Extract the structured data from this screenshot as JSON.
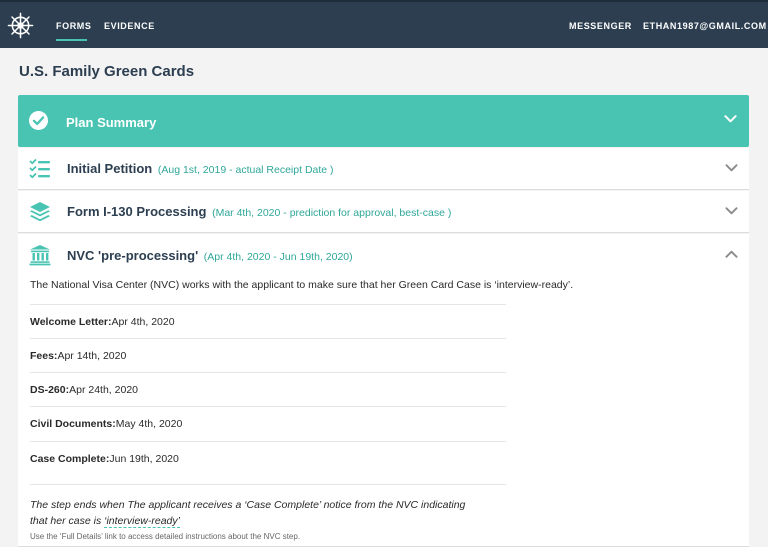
{
  "nav": {
    "logo_icon": "ships-wheel-icon",
    "links": [
      "FORMS",
      "EVIDENCE"
    ],
    "right_links": [
      "MESSENGER",
      "ETHAN1987@GMAIL.COM"
    ],
    "active": "FORMS"
  },
  "page": {
    "title": "U.S. Family Green Cards"
  },
  "summary": {
    "title": "Plan Summary",
    "icon": "check-circle-icon",
    "chevron": "chevron-down-icon"
  },
  "rows": [
    {
      "title": "Initial Petition",
      "subtitle": "(Aug 1st, 2019 - actual Receipt Date )",
      "icon": "checklist-icon",
      "chevron": "chevron-down-icon"
    },
    {
      "title": "Form I-130 Processing",
      "subtitle": "(Mar 4th, 2020 - prediction for approval, best-case )",
      "icon": "layers-icon",
      "chevron": "chevron-down-icon"
    },
    {
      "title": "NVC 'pre-processing'",
      "subtitle": "(Apr 4th, 2020 - Jun 19th, 2020)",
      "icon": "bank-building-icon",
      "chevron": "chevron-up-icon"
    }
  ],
  "nvc": {
    "intro": "The National Visa Center (NVC) works with the applicant to make sure that her Green Card Case is ‘interview-ready’.",
    "milestones": [
      {
        "label": "Welcome Letter:",
        "date": "Apr 4th, 2020"
      },
      {
        "label": "Fees:",
        "date": "Apr 14th, 2020"
      },
      {
        "label": "DS-260:",
        "date": "Apr 24th, 2020"
      },
      {
        "label": "Civil Documents:",
        "date": "May 4th, 2020"
      },
      {
        "label": "Case Complete:",
        "date": "Jun 19th, 2020"
      }
    ],
    "step_end_line1": "The step ends when The applicant receives a ‘Case Complete’ notice from the NVC indicating",
    "step_end_line2_prefix": "that her case is ",
    "step_end_link": "‘interview-ready’",
    "footnote": "Use the ‘Full Details’ link to access detailed instructions about the NVC step."
  },
  "colors": {
    "nav_bg": "#2c3e50",
    "accent": "#4ac4b2",
    "accent_text": "#2fa799",
    "page_bg": "#f3f3f3"
  }
}
